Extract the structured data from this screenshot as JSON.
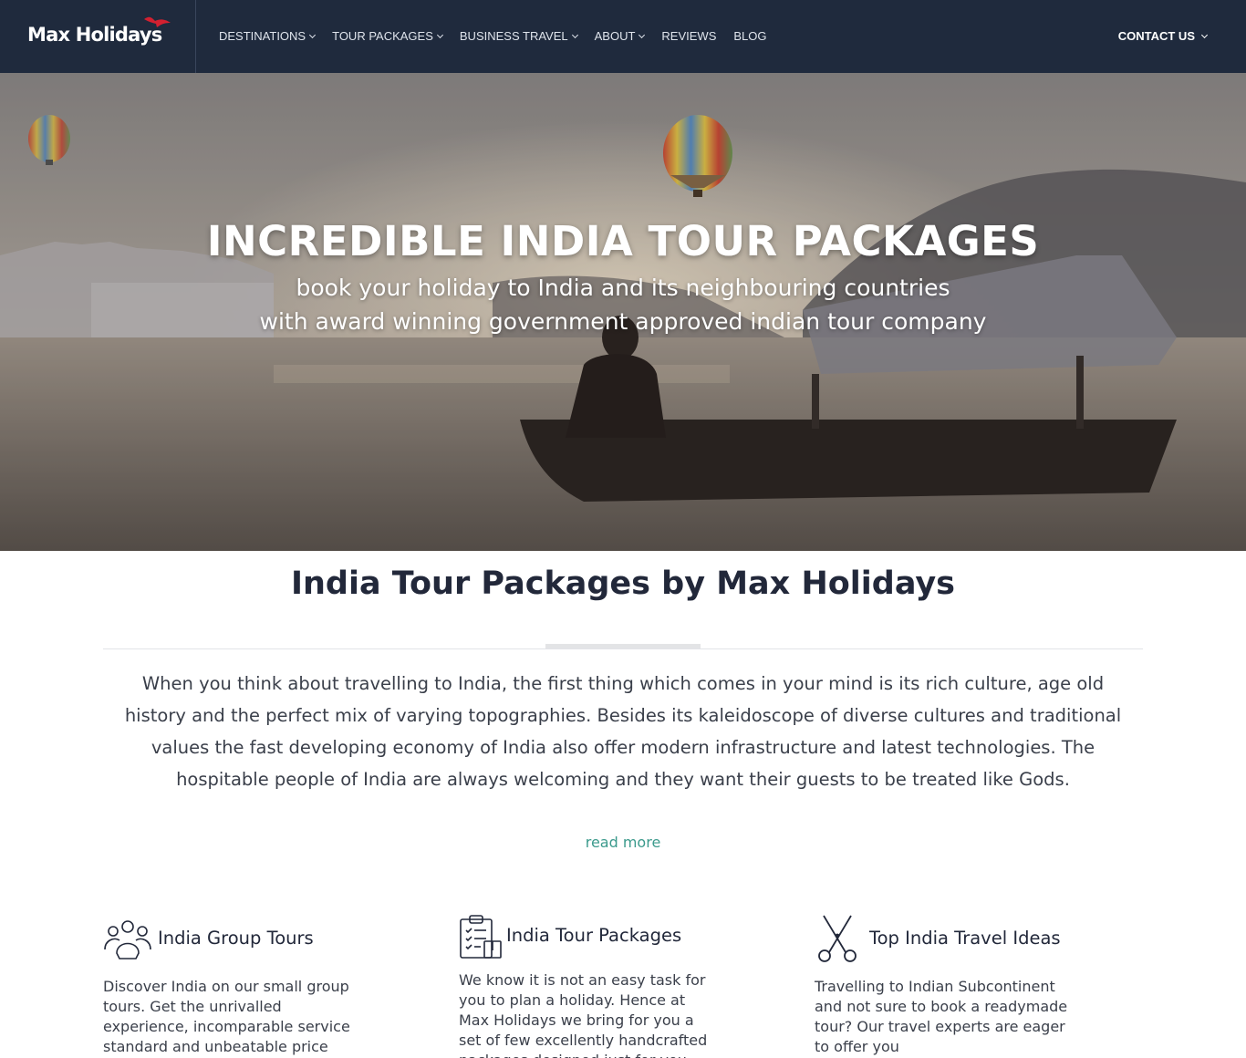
{
  "nav": {
    "logo": "Max Holidays",
    "items": [
      {
        "label": "DESTINATIONS",
        "dropdown": true
      },
      {
        "label": "TOUR PACKAGES",
        "dropdown": true
      },
      {
        "label": "BUSINESS TRAVEL",
        "dropdown": true
      },
      {
        "label": "ABOUT",
        "dropdown": true
      },
      {
        "label": "REVIEWS",
        "dropdown": false
      },
      {
        "label": "BLOG",
        "dropdown": false
      }
    ],
    "contact": "CONTACT US"
  },
  "hero": {
    "title": "INCREDIBLE INDIA TOUR PACKAGES",
    "subtitle_line1": "book your holiday to India and its neighbouring countries",
    "subtitle_line2": "with award winning government approved indian tour company"
  },
  "intro": {
    "title": "India Tour Packages by Max Holidays",
    "text": "When you think about travelling to India, the first thing which comes in your mind is its rich culture, age old history and the perfect mix of varying topographies. Besides its kaleidoscope of diverse cultures and traditional values the fast developing economy of India also offer modern infrastructure and latest technologies. The hospitable people of India are always welcoming and they want their guests to be treated like Gods.",
    "read_more": "read more"
  },
  "features": [
    {
      "title": "India Group Tours",
      "icon": "group-people-icon",
      "text": "Discover India on our small group tours. Get the unrivalled experience, incomparable service standard and unbeatable price"
    },
    {
      "title": "India Tour Packages",
      "icon": "clipboard-checklist-icon",
      "text": "We know it is not an easy task for you to plan a holiday. Hence at Max Holidays we bring for you a set of few excellently handcrafted packages designed just for you"
    },
    {
      "title": "Top India Travel Ideas",
      "icon": "scissors-icon",
      "text": "Travelling to Indian Subcontinent and not sure to book a readymade tour? Our travel experts are eager to offer you"
    }
  ],
  "colors": {
    "nav_bg": "#1f2a3d",
    "accent_link": "#3b9a8c",
    "logo_bird": "#d32030"
  }
}
